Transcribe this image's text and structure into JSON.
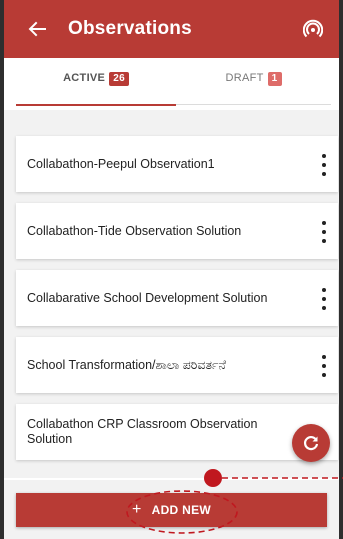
{
  "appbar": {
    "title": "Observations",
    "back_icon": "arrow-left-icon",
    "sync_icon": "sync-signal-icon"
  },
  "tabs": [
    {
      "label": "ACTIVE",
      "count": "26"
    },
    {
      "label": "DRAFT",
      "count": "1"
    }
  ],
  "observations": [
    {
      "title": "Collabathon-Peepul Observation1"
    },
    {
      "title": "Collabathon-Tide Observation Solution"
    },
    {
      "title": "Collabarative School Development Solution"
    },
    {
      "title": "School Transformation/ಶಾಲಾ ಪರಿವರ್ತನೆ"
    },
    {
      "title": "Collabathon CRP Classroom Observation Solution"
    }
  ],
  "fab": {
    "icon": "refresh-icon"
  },
  "footer": {
    "add_label": "ADD NEW",
    "plus": "+"
  },
  "colors": {
    "primary": "#b83b35",
    "annotation": "#c0181f",
    "background": "#f2f2f2"
  }
}
